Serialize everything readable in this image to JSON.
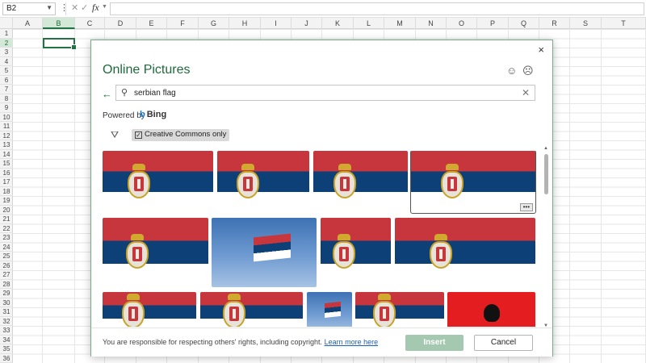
{
  "formula_bar": {
    "name_box": "B2",
    "fx_label": "fx",
    "formula_value": ""
  },
  "columns": [
    "A",
    "B",
    "C",
    "D",
    "E",
    "F",
    "G",
    "H",
    "I",
    "J",
    "K",
    "L",
    "M",
    "N",
    "O",
    "P",
    "Q",
    "R",
    "S",
    "T"
  ],
  "selected_column": "B",
  "rows": [
    "1",
    "2",
    "3",
    "4",
    "5",
    "6",
    "7",
    "8",
    "9",
    "10",
    "11",
    "12",
    "13",
    "14",
    "15",
    "16",
    "17",
    "18",
    "19",
    "20",
    "21",
    "22",
    "23",
    "24",
    "25",
    "26",
    "27",
    "28",
    "29",
    "30",
    "31",
    "32",
    "33",
    "34",
    "35",
    "36"
  ],
  "selected_row": "2",
  "dialog": {
    "title": "Online Pictures",
    "close_icon": "×",
    "smile_icon": "☺",
    "frown_icon": "☹",
    "back_icon": "←",
    "search_icon": "⚲",
    "search_value": "serbian flag",
    "clear_icon": "✕",
    "powered_by": "Powered by",
    "bing_label": "Bing",
    "filter_icon": "⛛",
    "creative_commons_checked": true,
    "creative_commons_label": "Creative Commons only",
    "more_icon": "•••",
    "colors": {
      "serbia_red": "#c6363c",
      "serbia_blue": "#0c4076",
      "serbia_white": "#ffffff",
      "albania_red": "#e41e20",
      "accent_green": "#217346"
    },
    "images": [
      {
        "name": "serbian-flag-grunge-1",
        "palette": "serbia"
      },
      {
        "name": "serbian-flag-socialist",
        "palette": "serbia"
      },
      {
        "name": "serbian-flag-coat-of-arms-large",
        "palette": "serbia"
      },
      {
        "name": "serbian-flag-selected",
        "palette": "serbia"
      },
      {
        "name": "serbian-flag-grunge-2",
        "palette": "serbia"
      },
      {
        "name": "serbian-flag-on-pole-sky",
        "palette": "sky"
      },
      {
        "name": "serbian-flag-waving",
        "palette": "serbia"
      },
      {
        "name": "serbian-flag-eagle",
        "palette": "serbia"
      },
      {
        "name": "serbian-flag-close-up",
        "palette": "serbia"
      },
      {
        "name": "serbian-flag-dark",
        "palette": "serbia"
      },
      {
        "name": "serbian-flag-building",
        "palette": "sky"
      },
      {
        "name": "serbian-flag-plain",
        "palette": "serbia"
      },
      {
        "name": "albanian-flag",
        "palette": "albania"
      }
    ],
    "footer": {
      "notice": "You are responsible for respecting others' rights, including copyright.",
      "learn_more": "Learn more here",
      "insert_label": "Insert",
      "cancel_label": "Cancel"
    }
  }
}
